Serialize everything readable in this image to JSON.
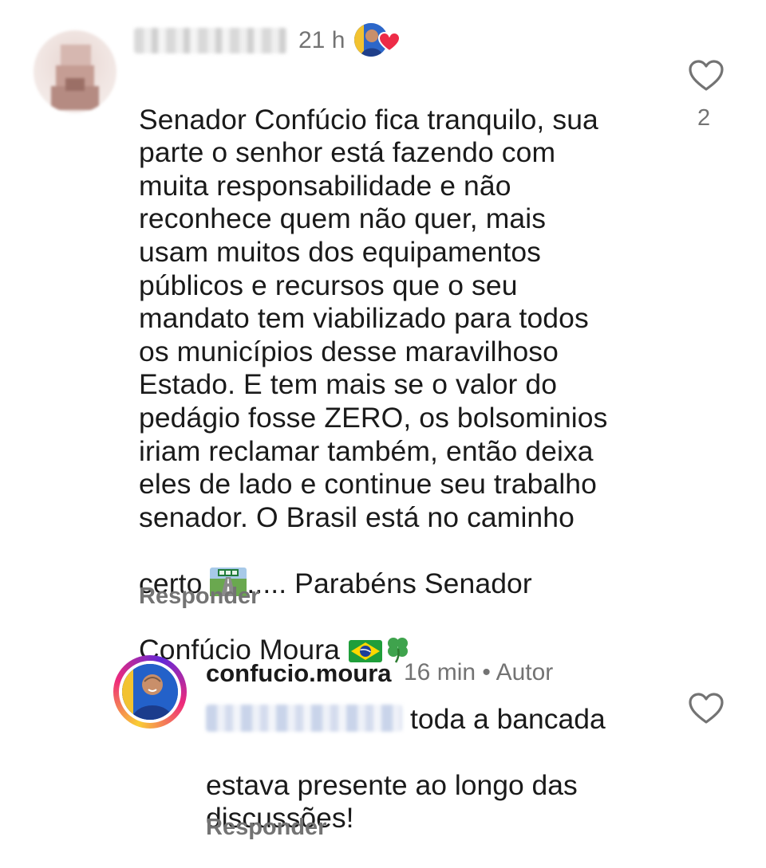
{
  "comment": {
    "time": "21 h",
    "text_lines": [
      "Senador Confúcio fica tranquilo, sua",
      "parte o senhor está fazendo com",
      "muita responsabilidade e não",
      "reconhece quem não quer, mais",
      "usam muitos dos equipamentos",
      "públicos e recursos que o seu",
      "mandato tem viabilizado para todos",
      "os municípios desse maravilhoso",
      "Estado. E tem mais se o valor do",
      "pedágio fosse ZERO, os bolsominios",
      "iriam reclamar também, então deixa",
      "eles de lado e continue seu trabalho",
      "senador. O Brasil está no caminho"
    ],
    "line14_before_emoji": "certo ",
    "line14_after_emoji": "..... Parabéns Senador",
    "line15_text": "Confúcio Moura ",
    "emojis": [
      "motorway-emoji",
      "brazil-flag-emoji",
      "four-leaf-clover-emoji"
    ],
    "reply_label": "Responder",
    "like_count": "2",
    "liked_by_author_icon": "author-avatar-with-red-heart"
  },
  "reply": {
    "username": "confucio.moura",
    "time": "16 min",
    "separator": " • ",
    "author_badge": "Autor",
    "text_first_line": "toda a bancada",
    "text_rest_lines": [
      "estava presente ao longo das",
      "discussões!"
    ],
    "reply_label": "Responder"
  },
  "colors": {
    "text_primary": "#1a1a1a",
    "text_secondary": "#737373",
    "heart_red": "#ed2b47",
    "story_ring": [
      "#f9ce34",
      "#ee2a7b",
      "#6228d7"
    ]
  }
}
